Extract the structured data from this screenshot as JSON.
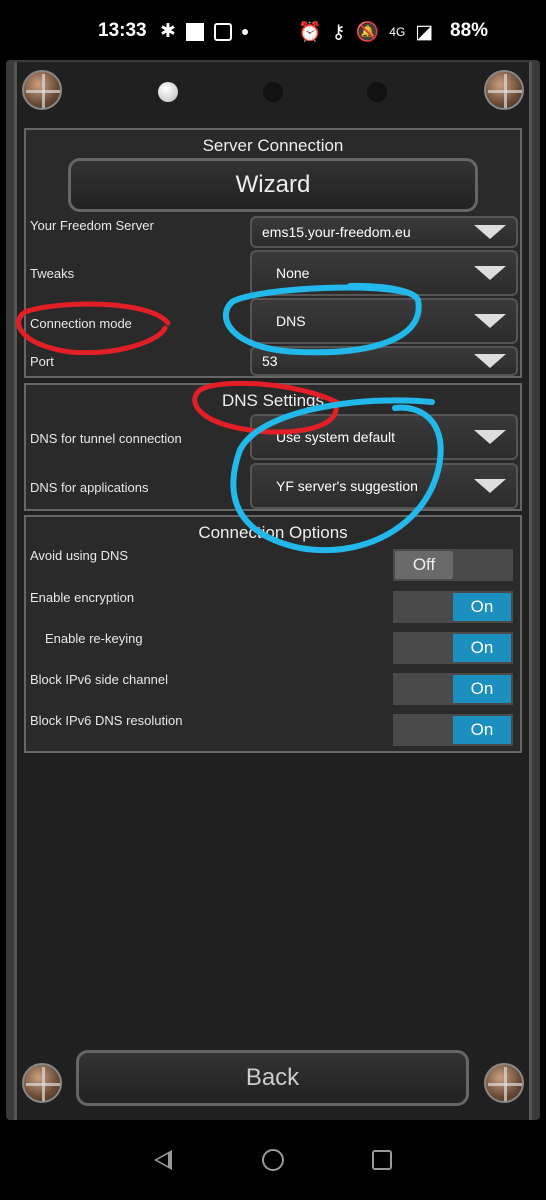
{
  "status": {
    "time": "13:33",
    "battery": "88%",
    "network": "4G"
  },
  "server_connection": {
    "title": "Server Connection",
    "wizard_label": "Wizard",
    "rows": [
      {
        "label": "Your Freedom Server",
        "value": "ems15.your-freedom.eu"
      },
      {
        "label": "Tweaks",
        "value": "None"
      },
      {
        "label": "Connection mode",
        "value": "DNS"
      },
      {
        "label": "Port",
        "value": "53"
      }
    ]
  },
  "dns_settings": {
    "title": "DNS Settings",
    "rows": [
      {
        "label": "DNS for tunnel connection",
        "value": "Use system default"
      },
      {
        "label": "DNS for applications",
        "value": "YF server's suggestion"
      }
    ]
  },
  "connection_options": {
    "title": "Connection Options",
    "rows": [
      {
        "label": "Avoid using DNS",
        "state": "Off"
      },
      {
        "label": "Enable encryption",
        "state": "On"
      },
      {
        "label": "Enable re-keying",
        "state": "On"
      },
      {
        "label": "Block IPv6 side channel",
        "state": "On"
      },
      {
        "label": "Block IPv6 DNS resolution",
        "state": "On"
      }
    ]
  },
  "back_label": "Back",
  "colors": {
    "accent": "#1b8fbd",
    "annotation_red": "#e21f26",
    "annotation_blue": "#22b8ea"
  }
}
